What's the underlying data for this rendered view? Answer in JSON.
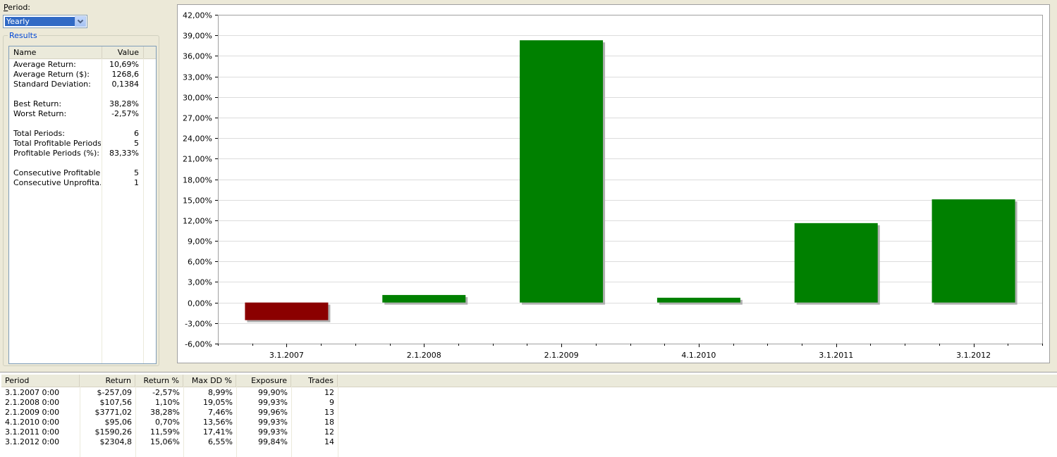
{
  "period": {
    "label_prefix": "P",
    "label_rest": "eriod:",
    "selected": "Yearly"
  },
  "results": {
    "group_title": "Results",
    "columns": [
      "Name",
      "Value"
    ],
    "rows": [
      {
        "name": "Average Return:",
        "value": "10,69%"
      },
      {
        "name": "Average Return ($):",
        "value": "1268,6"
      },
      {
        "name": "Standard Deviation:",
        "value": "0,1384"
      },
      {
        "name": "",
        "value": ""
      },
      {
        "name": "Best Return:",
        "value": "38,28%"
      },
      {
        "name": "Worst Return:",
        "value": "-2,57%"
      },
      {
        "name": "",
        "value": ""
      },
      {
        "name": "Total Periods:",
        "value": "6"
      },
      {
        "name": "Total Profitable Periods:",
        "value": "5"
      },
      {
        "name": "Profitable Periods (%):",
        "value": "83,33%"
      },
      {
        "name": "",
        "value": ""
      },
      {
        "name": "Consecutive Profitable:",
        "value": "5"
      },
      {
        "name": "Consecutive Unprofita...",
        "value": "1"
      }
    ]
  },
  "chart_data": {
    "type": "bar",
    "categories": [
      "3.1.2007",
      "2.1.2008",
      "2.1.2009",
      "4.1.2010",
      "3.1.2011",
      "3.1.2012"
    ],
    "values": [
      -2.57,
      1.1,
      38.28,
      0.7,
      11.59,
      15.06
    ],
    "ylim": [
      -6,
      42
    ],
    "ytick_step": 3,
    "ytick_labels": [
      "-6,00%",
      "-3,00%",
      "0,00%",
      "3,00%",
      "6,00%",
      "9,00%",
      "12,00%",
      "15,00%",
      "18,00%",
      "21,00%",
      "24,00%",
      "27,00%",
      "30,00%",
      "33,00%",
      "36,00%",
      "39,00%",
      "42,00%"
    ],
    "grid": true,
    "colors": {
      "positive": "#008000",
      "negative": "#8b0000",
      "shadow": "#b0b0b0",
      "grid": "#dcdcdc"
    }
  },
  "table": {
    "columns": [
      "Period",
      "Return",
      "Return %",
      "Max DD %",
      "Exposure",
      "Trades"
    ],
    "rows": [
      [
        "3.1.2007 0:00",
        "$-257,09",
        "-2,57%",
        "8,99%",
        "99,90%",
        "12"
      ],
      [
        "2.1.2008 0:00",
        "$107,56",
        "1,10%",
        "19,05%",
        "99,93%",
        "9"
      ],
      [
        "2.1.2009 0:00",
        "$3771,02",
        "38,28%",
        "7,46%",
        "99,96%",
        "13"
      ],
      [
        "4.1.2010 0:00",
        "$95,06",
        "0,70%",
        "13,56%",
        "99,93%",
        "18"
      ],
      [
        "3.1.2011 0:00",
        "$1590,26",
        "11,59%",
        "17,41%",
        "99,93%",
        "12"
      ],
      [
        "3.1.2012 0:00",
        "$2304,8",
        "15,06%",
        "6,55%",
        "99,84%",
        "14"
      ]
    ]
  }
}
